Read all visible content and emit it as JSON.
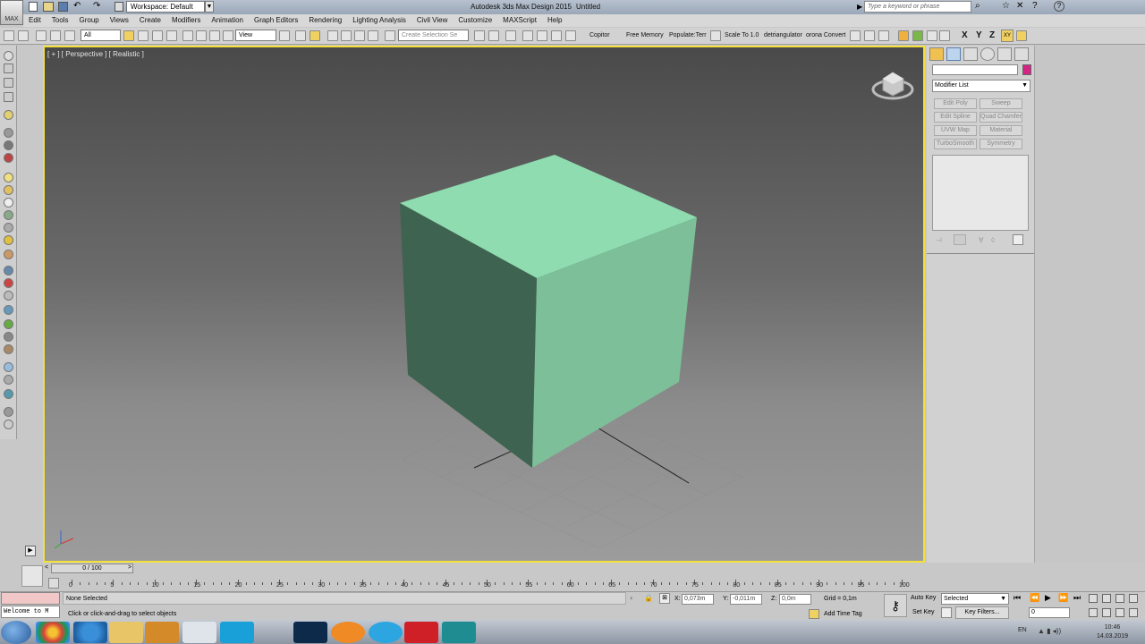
{
  "title_bar": {
    "logo_text": "MAX",
    "workspace": "Workspace: Default",
    "app_title": "Autodesk 3ds Max Design 2015",
    "doc_title": "Untitled",
    "search_placeholder": "Type a keyword or phrase"
  },
  "menu": [
    "Edit",
    "Tools",
    "Group",
    "Views",
    "Create",
    "Modifiers",
    "Animation",
    "Graph Editors",
    "Rendering",
    "Lighting Analysis",
    "Civil View",
    "Customize",
    "MAXScript",
    "Help"
  ],
  "toolbar": {
    "selection_filter": "All",
    "reference_coord": "View",
    "selection_set_placeholder": "Create Selection Se",
    "text_buttons": [
      "Copitor",
      "Free Memory",
      "Populate:Terr",
      "Scale To 1.0",
      "detriangulator",
      "orona Convert"
    ],
    "axis_buttons": [
      "X",
      "Y",
      "Z",
      "XY"
    ]
  },
  "viewport": {
    "label": "[ + ] [ Perspective ] [ Realistic ]",
    "object": "box",
    "object_color_top": "#8fdcb0",
    "object_color_right": "#7cbf98",
    "object_color_left": "#3e6350"
  },
  "command_panel": {
    "modifier_list": "Modifier List",
    "modifier_buttons": [
      "Edit Poly",
      "Sweep",
      "Edit Spline",
      "Quad Chamfer",
      "UVW Map",
      "Material",
      "TurboSmooth",
      "Symmetry"
    ],
    "object_color": "#d42585"
  },
  "timeline": {
    "slider": "0 / 100",
    "ticks": [
      "0",
      "5",
      "10",
      "15",
      "20",
      "25",
      "30",
      "35",
      "40",
      "45",
      "50",
      "55",
      "60",
      "65",
      "70",
      "75",
      "80",
      "85",
      "90",
      "95",
      "100"
    ]
  },
  "status": {
    "maxscript_listener": "Welcome to M",
    "selection": "None Selected",
    "prompt": "Click or click-and-drag to select objects",
    "x_label": "X:",
    "x_value": "0,073m",
    "y_label": "Y:",
    "y_value": "-0,011m",
    "z_label": "Z:",
    "z_value": "0,0m",
    "grid": "Grid = 0,1m",
    "add_time_tag": "Add Time Tag",
    "auto_key": "Auto Key",
    "set_key": "Set Key",
    "key_mode": "Selected",
    "key_filters": "Key Filters...",
    "frame": "0"
  },
  "taskbar": {
    "language": "EN",
    "time": "10:46",
    "date": "14.03.2019"
  }
}
